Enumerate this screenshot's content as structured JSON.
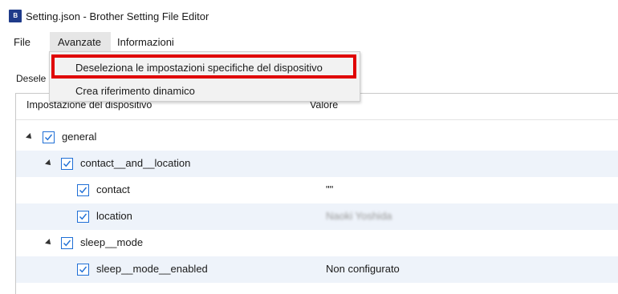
{
  "window": {
    "title": "Setting.json - Brother Setting File Editor",
    "icon_text": "B"
  },
  "menubar": {
    "items": [
      "File",
      "Avanzate",
      "Informazioni"
    ],
    "active": "Avanzate"
  },
  "dropdown": {
    "items": [
      "Deseleziona le impostazioni specifiche del dispositivo",
      "Crea riferimento dinamico"
    ],
    "highlighted_index": 0,
    "highlight_color": "#e00000"
  },
  "toolbar": {
    "truncated_label": "Desele"
  },
  "table": {
    "columns": [
      "Impostazione del dispositivo",
      "Valore"
    ],
    "rows": [
      {
        "label": "general",
        "value": "",
        "checked": true
      },
      {
        "label": "contact__and__location",
        "value": "",
        "checked": true
      },
      {
        "label": "contact",
        "value": "\"\"",
        "checked": true
      },
      {
        "label": "location",
        "value": "Naoki Yoshida",
        "checked": true
      },
      {
        "label": "sleep__mode",
        "value": "",
        "checked": true
      },
      {
        "label": "sleep__mode__enabled",
        "value": "Non configurato",
        "checked": true
      }
    ]
  },
  "colors": {
    "checkbox": "#1f6fd6",
    "row_alt": "#eef3fa",
    "menu_active_bg": "#e6e6e6"
  }
}
